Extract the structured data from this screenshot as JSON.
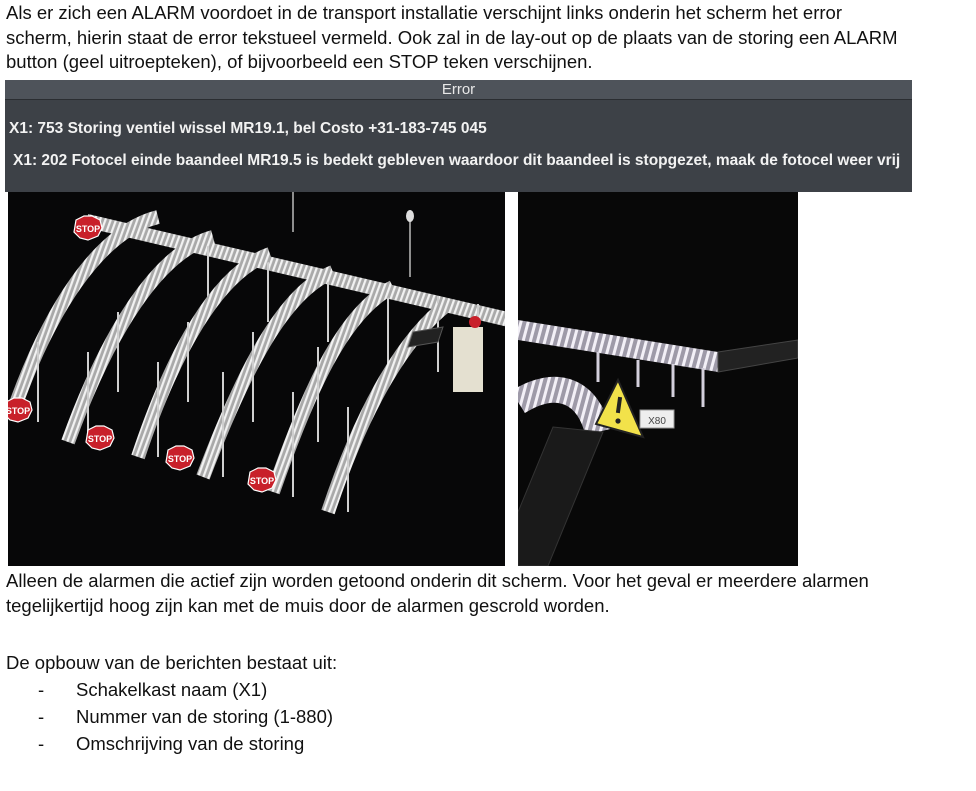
{
  "intro_text": "Als er zich een ALARM voordoet in de transport installatie verschijnt links onderin het scherm het error scherm, hierin staat de error tekstueel vermeld. Ook zal in de lay-out op de plaats van de storing een ALARM button (geel uitroepteken), of bijvoorbeeld een STOP teken verschijnen.",
  "error_panel": {
    "title": "Error",
    "lines": [
      "X1: 753 Storing ventiel wissel MR19.1, bel Costo +31-183-745 045",
      "X1: 202 Fotocel einde baandeel MR19.5 is bedekt gebleven waardoor dit baandeel is stopgezet, maak de fotocel weer vrij"
    ]
  },
  "photo_left": {
    "stop_signs": [
      "STOP",
      "STOP",
      "STOP",
      "STOP",
      "STOP"
    ]
  },
  "photo_right": {
    "label": "X80",
    "icons": [
      "alarm-warning-icon"
    ]
  },
  "after_text": "Alleen de alarmen die actief zijn worden getoond onderin dit scherm. Voor het geval er meerdere alarmen tegelijkertijd hoog zijn kan met de muis door de alarmen gescrold worden.",
  "structure_intro": "De opbouw van de berichten bestaat uit:",
  "structure_items": [
    "Schakelkast naam (X1)",
    "Nummer van de storing (1-880)",
    "Omschrijving van de storing"
  ],
  "colors": {
    "stop_red": "#c8202a",
    "warning_yellow": "#f2e24a",
    "panel_bg": "#3d4147"
  }
}
